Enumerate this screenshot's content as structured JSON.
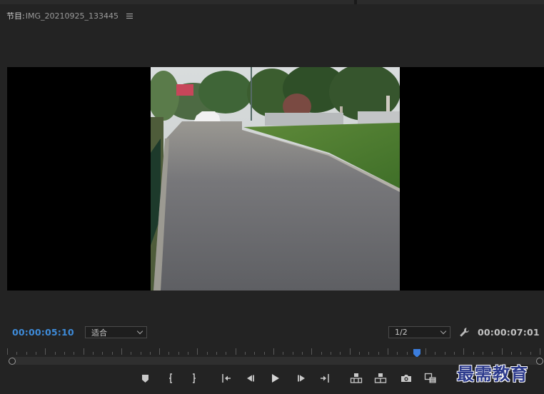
{
  "panel": {
    "title_prefix": "节目:",
    "sequence_name": "IMG_20210925_133445"
  },
  "playback": {
    "current_timecode": "00:00:05:10",
    "total_duration": "00:00:07:01",
    "zoom_select_value": "适合",
    "resolution_select_value": "1/2",
    "playhead_position_fraction": 0.77
  },
  "transport_buttons": [
    {
      "name": "add-marker",
      "icon": "marker-icon"
    },
    {
      "name": "mark-in",
      "icon": "mark-in-icon"
    },
    {
      "name": "mark-out",
      "icon": "mark-out-icon"
    },
    {
      "name": "go-to-in",
      "icon": "go-to-in-icon"
    },
    {
      "name": "step-back",
      "icon": "step-back-icon"
    },
    {
      "name": "play",
      "icon": "play-icon"
    },
    {
      "name": "step-forward",
      "icon": "step-forward-icon"
    },
    {
      "name": "go-to-out",
      "icon": "go-to-out-icon"
    },
    {
      "name": "lift",
      "icon": "lift-icon"
    },
    {
      "name": "extract",
      "icon": "extract-icon"
    },
    {
      "name": "export-frame",
      "icon": "camera-icon"
    },
    {
      "name": "comparison-view",
      "icon": "comparison-icon"
    }
  ],
  "watermark": {
    "text": "最需教育",
    "color": "#2c3a8c"
  },
  "colors": {
    "accent_timecode": "#3e8bd9",
    "playhead": "#3b7ddd",
    "panel_background": "#232323"
  }
}
